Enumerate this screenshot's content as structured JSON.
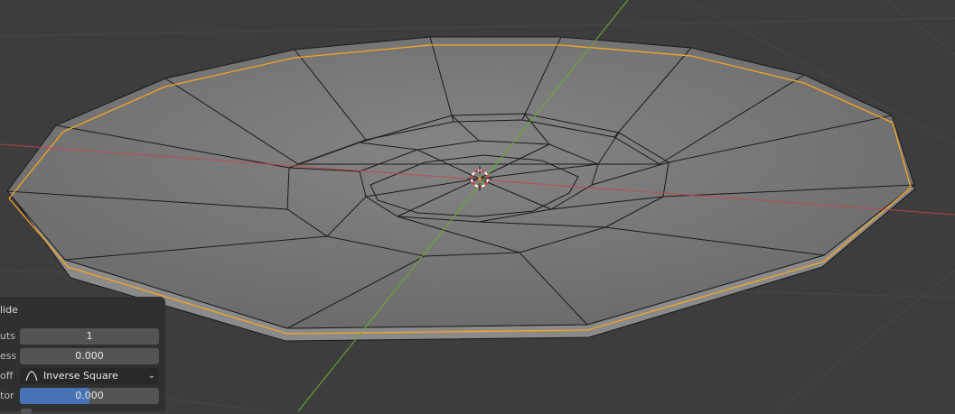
{
  "panel": {
    "title": "lide",
    "rows": [
      {
        "label": "uts",
        "value": "1"
      },
      {
        "label": "ess",
        "value": "0.000"
      },
      {
        "label": "off",
        "value": "Inverse Square"
      },
      {
        "label": "tor",
        "value": "0.000"
      }
    ],
    "factor_fraction": 0.5
  },
  "colors": {
    "viewport_bg": "#3d3d3d",
    "x_axis": "#c04655",
    "y_axis": "#6fa832",
    "edge_selected": "#f5a623",
    "mesh_face": "#7a7a7a"
  },
  "icons": [
    "falloff-curve-icon",
    "chevron-down-icon",
    "3d-cursor-icon"
  ]
}
